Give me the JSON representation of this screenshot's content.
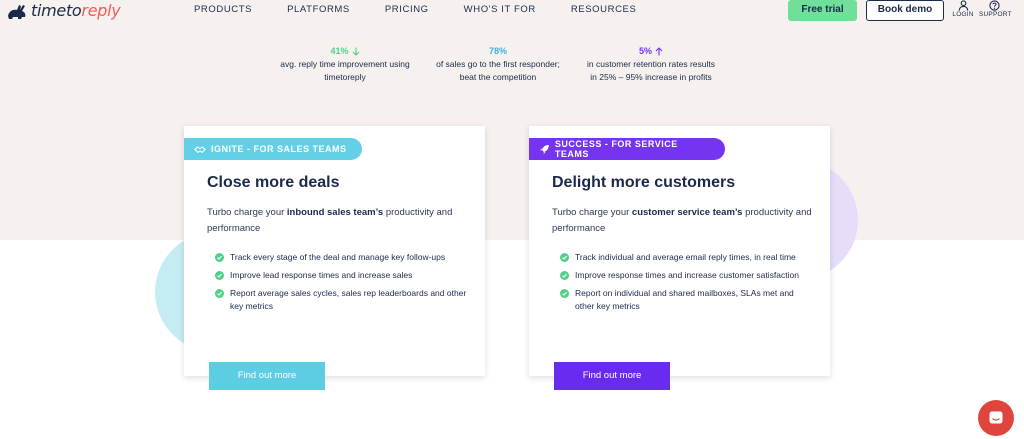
{
  "brand": {
    "name_part1": "timeto",
    "name_part2": "reply"
  },
  "nav": {
    "items": [
      "PRODUCTS",
      "PLATFORMS",
      "PRICING",
      "WHO'S IT FOR",
      "RESOURCES"
    ]
  },
  "header": {
    "free_trial": "Free trial",
    "book_demo": "Book demo",
    "login": "LOGIN",
    "support": "SUPPORT"
  },
  "stats": [
    {
      "value": "41%",
      "line1": "avg. reply time improvement using",
      "line2": "timetoreply"
    },
    {
      "value": "78%",
      "line1": "of sales go to the first responder;",
      "line2": "beat the competition"
    },
    {
      "value": "5%",
      "line1": "in customer retention rates results",
      "line2": "in 25% – 95% increase in profits"
    }
  ],
  "cards": {
    "sales": {
      "tag": "IGNITE - FOR SALES TEAMS",
      "title": "Close more deals",
      "desc_pre": "Turbo charge your ",
      "desc_bold": "inbound sales team’s",
      "desc_post": " productivity and performance",
      "bullets": [
        "Track every stage of the deal and manage key follow-ups",
        "Improve lead response times and increase sales",
        "Report average sales cycles, sales rep leaderboards and other key metrics"
      ],
      "button": "Find out more"
    },
    "service": {
      "tag": "SUCCESS - FOR SERVICE TEAMS",
      "title": "Delight more customers",
      "desc_pre": "Turbo charge your ",
      "desc_bold": "customer service team’s",
      "desc_post": " productivity and performance",
      "bullets": [
        "Track individual and average email reply times, in real time",
        "Improve response times and increase customer satisfaction",
        "Report on individual and shared mailboxes, SLAs met and other key metrics"
      ],
      "button": "Find out more"
    }
  },
  "colors": {
    "green": "#4fd18a",
    "blue": "#3ab1e0",
    "purple": "#7434f0",
    "chat": "#e0453d"
  }
}
